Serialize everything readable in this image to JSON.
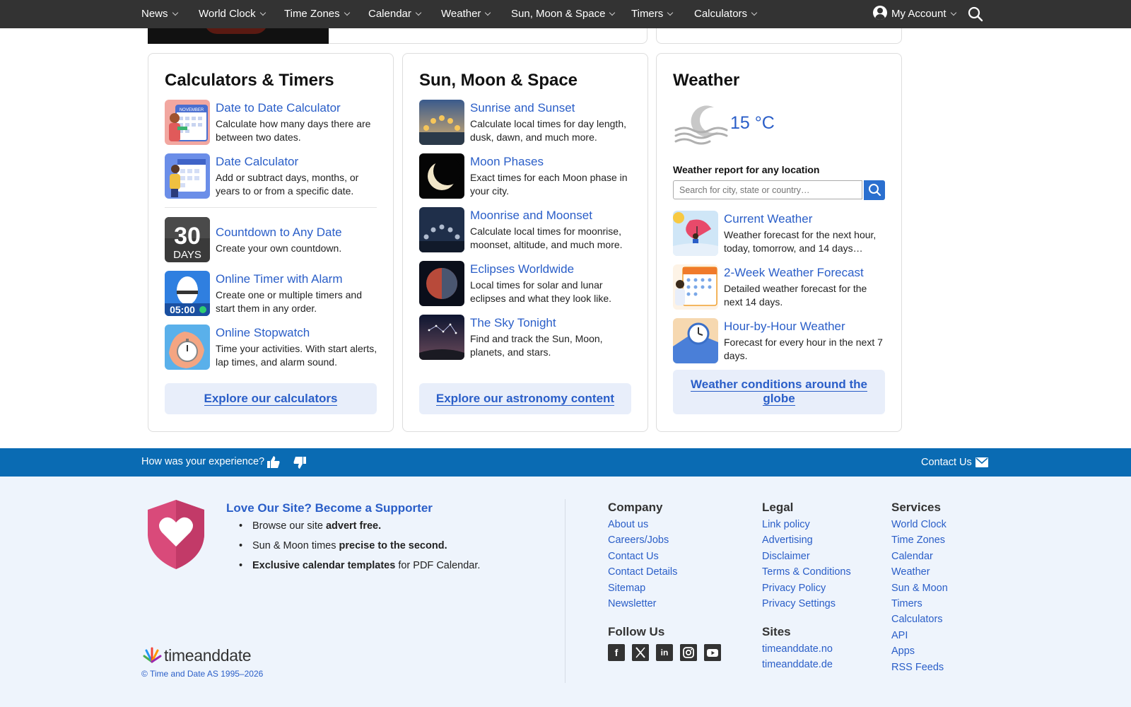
{
  "nav": {
    "items": [
      "News",
      "World Clock",
      "Time Zones",
      "Calendar",
      "Weather",
      "Sun, Moon & Space",
      "Timers",
      "Calculators"
    ],
    "account": "My Account"
  },
  "calc": {
    "title": "Calculators & Timers",
    "entries": [
      {
        "title": "Date to Date Calculator",
        "desc": "Calculate how many days there are between two dates."
      },
      {
        "title": "Date Calculator",
        "desc": "Add or subtract days, months, or years to or from a specific date."
      },
      {
        "title": "Countdown to Any Date",
        "desc": "Create your own countdown."
      },
      {
        "title": "Online Timer with Alarm",
        "desc": "Create one or multiple timers and start them in any order."
      },
      {
        "title": "Online Stopwatch",
        "desc": "Time your activities. With start alerts, lap times, and alarm sound."
      }
    ],
    "thumb_countdown": {
      "num": "30",
      "unit": "DAYS"
    },
    "thumb_timer": {
      "time": "05:00"
    },
    "thumb_calendar_month": "NOVEMBER",
    "explore": "Explore our calculators"
  },
  "astro": {
    "title": "Sun, Moon & Space",
    "entries": [
      {
        "title": "Sunrise and Sunset",
        "desc": "Calculate local times for day length, dusk, dawn, and much more."
      },
      {
        "title": "Moon Phases",
        "desc": "Exact times for each Moon phase in your city."
      },
      {
        "title": "Moonrise and Moonset",
        "desc": "Calculate local times for moonrise, moonset, altitude, and much more."
      },
      {
        "title": "Eclipses Worldwide",
        "desc": "Local times for solar and lunar eclipses and what they look like."
      },
      {
        "title": "The Sky Tonight",
        "desc": "Find and track the Sun, Moon, planets, and stars."
      }
    ],
    "explore": "Explore our astronomy content"
  },
  "weather": {
    "title": "Weather",
    "temp": "15 °C",
    "report_label": "Weather report for any location",
    "search_placeholder": "Search for city, state or country…",
    "entries": [
      {
        "title": "Current Weather",
        "desc": "Weather forecast for the next hour, today, tomorrow, and 14 days…"
      },
      {
        "title": "2-Week Weather Forecast",
        "desc": "Detailed weather forecast for the next 14 days."
      },
      {
        "title": "Hour-by-Hour Weather",
        "desc": "Forecast for every hour in the next 7 days."
      }
    ],
    "explore": "Weather conditions around the globe"
  },
  "feedback": {
    "question": "How was your experience?",
    "contact": "Contact Us"
  },
  "footer": {
    "supporter_title": "Love Our Site? Become a Supporter",
    "bullets": [
      {
        "pre": "Browse our site ",
        "bold": "advert free.",
        "post": ""
      },
      {
        "pre": "Sun & Moon times ",
        "bold": "precise to the second.",
        "post": ""
      },
      {
        "pre": "",
        "bold": "Exclusive calendar templates",
        "post": " for PDF Calendar."
      }
    ],
    "logo": "timeanddate",
    "copyright": "© Time and Date AS 1995–2026",
    "company": {
      "title": "Company",
      "links": [
        "About us",
        "Careers/Jobs",
        "Contact Us",
        "Contact Details",
        "Sitemap",
        "Newsletter"
      ]
    },
    "legal": {
      "title": "Legal",
      "links": [
        "Link policy",
        "Advertising",
        "Disclaimer",
        "Terms & Conditions",
        "Privacy Policy",
        "Privacy Settings"
      ]
    },
    "services": {
      "title": "Services",
      "links": [
        "World Clock",
        "Time Zones",
        "Calendar",
        "Weather",
        "Sun & Moon",
        "Timers",
        "Calculators",
        "API",
        "Apps",
        "RSS Feeds"
      ]
    },
    "follow": {
      "title": "Follow Us",
      "icons": [
        "facebook-icon",
        "x-icon",
        "linkedin-icon",
        "instagram-icon",
        "youtube-icon"
      ]
    },
    "sites": {
      "title": "Sites",
      "links": [
        "timeanddate.no",
        "timeanddate.de"
      ]
    }
  },
  "colors": {
    "link": "#2a5ec8",
    "nav_bg": "#333333",
    "feedback_bg": "#0a6bb3",
    "footer_bg": "#eef4fc",
    "explore_bg": "#e8eefa"
  }
}
